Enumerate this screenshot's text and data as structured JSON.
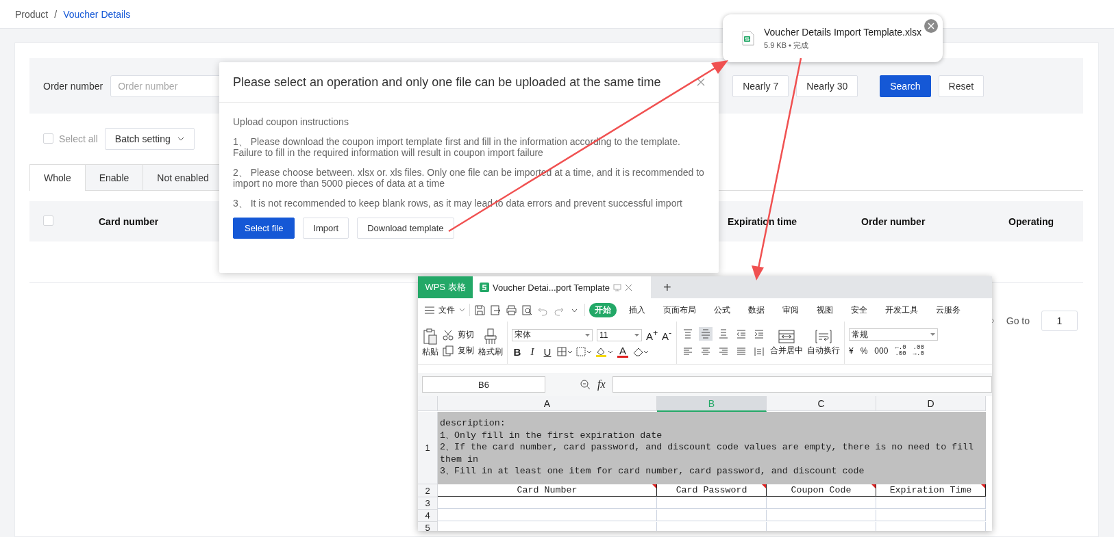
{
  "breadcrumb": [
    {
      "label": "Product",
      "current": false
    },
    {
      "label": "Voucher Details",
      "current": true
    }
  ],
  "breadcrumb_separator": "/",
  "filters": {
    "order_number": {
      "label": "Order number",
      "placeholder": "Order number"
    },
    "quick_ranges": [
      {
        "label": "Nearly 7"
      },
      {
        "label": "Nearly 30"
      }
    ],
    "search": "Search",
    "reset": "Reset"
  },
  "select_all": {
    "label": "Select all",
    "checked": false
  },
  "batch_setting": "Batch setting",
  "tabs": [
    {
      "label": "Whole",
      "selected": true
    },
    {
      "label": "Enable",
      "selected": false
    },
    {
      "label": "Not enabled",
      "selected": false
    }
  ],
  "table": {
    "header_checked": false,
    "columns": [
      "Card number",
      "Expiration time",
      "Order number",
      "Operating"
    ]
  },
  "pagination": {
    "goto_label": "Go to",
    "goto_value": "1"
  },
  "modal": {
    "title": "Please select an operation and only one file can be uploaded at the same time",
    "heading": "Upload coupon instructions",
    "items": [
      "1、 Please download the coupon import template first and fill in the information according to the template. Failure to fill in the required information will result in coupon import failure",
      "2、 Please choose between. xlsx or. xls files. Only one file can be imported at a time, and it is recommended to import no more than 5000 pieces of data at a time",
      "3、 It is not recommended to keep blank rows, as it may lead to data errors and prevent successful import"
    ],
    "buttons": [
      {
        "label": "Select file",
        "kind": "primary"
      },
      {
        "label": "Import",
        "kind": "default"
      },
      {
        "label": "Download template",
        "kind": "default"
      }
    ]
  },
  "download": {
    "filename": "Voucher Details Import Template.xlsx",
    "meta": "5.9 KB • 完成"
  },
  "spreadsheet": {
    "app_tab": "WPS 表格",
    "doc_tab": "Voucher Detai...port Template",
    "new_tab": "+",
    "file_menu": "文件",
    "ribbon_tabs": [
      {
        "label": "开始",
        "selected": true
      },
      {
        "label": "插入",
        "selected": false
      },
      {
        "label": "页面布局",
        "selected": false
      },
      {
        "label": "公式",
        "selected": false
      },
      {
        "label": "数据",
        "selected": false
      },
      {
        "label": "审阅",
        "selected": false
      },
      {
        "label": "视图",
        "selected": false
      },
      {
        "label": "安全",
        "selected": false
      },
      {
        "label": "开发工具",
        "selected": false
      },
      {
        "label": "云服务",
        "selected": false
      }
    ],
    "clipboard": {
      "paste": "粘贴",
      "cut": "剪切",
      "copy": "复制",
      "painter": "格式刷"
    },
    "font": {
      "name": "宋体",
      "size": "11",
      "grow": "A$^{+}$",
      "shrink": "A$^{-}$",
      "styles": [
        "B",
        "I",
        "U"
      ],
      "color_letter": "A"
    },
    "align": [
      {
        "kind": "top",
        "selected": false
      },
      {
        "kind": "middle",
        "selected": true
      },
      {
        "kind": "bottom",
        "selected": false
      },
      {
        "kind": "outdent",
        "selected": false
      },
      {
        "kind": "indent",
        "selected": false
      },
      {
        "kind": "left",
        "selected": false
      },
      {
        "kind": "center",
        "selected": false
      },
      {
        "kind": "right",
        "selected": false
      },
      {
        "kind": "justify",
        "selected": false
      },
      {
        "kind": "distributed",
        "selected": false
      }
    ],
    "merge": "合并居中",
    "wrap": "自动换行",
    "number": {
      "format": "常规",
      "buttons": [
        "¥",
        "%",
        "000"
      ],
      "decimals": [
        {
          "top": "←.0",
          "bottom": ".00"
        },
        {
          "top": ".00",
          "bottom": "→.0"
        }
      ]
    },
    "name_box": "B6",
    "fx": "fx",
    "columns": [
      {
        "label": "A",
        "selected": false
      },
      {
        "label": "B",
        "selected": true
      },
      {
        "label": "C",
        "selected": false
      },
      {
        "label": "D",
        "selected": false
      }
    ],
    "rows": [
      {
        "number": "1",
        "kind": "note",
        "lines": [
          "description:",
          "1、Only fill in the first expiration date",
          "2、If the card number, card password, and discount code values are empty, there is no need to fill them in",
          "3、Fill in at least one item for card number, card password, and discount code"
        ]
      },
      {
        "number": "2",
        "kind": "header",
        "cells": [
          "Card Number",
          "Card Password",
          "Coupon Code",
          "Expiration Time"
        ]
      },
      {
        "number": "3",
        "kind": "empty"
      },
      {
        "number": "4",
        "kind": "empty"
      },
      {
        "number": "5",
        "kind": "empty"
      }
    ]
  }
}
